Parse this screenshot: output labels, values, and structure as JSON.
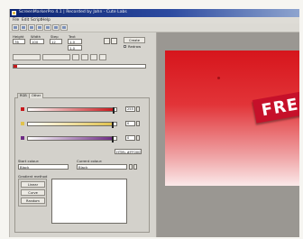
{
  "window": {
    "title": "ScreenMarkerPro 4.1 | Recorded by Jahn - Cute Labs"
  },
  "menu": [
    "File",
    "Edit",
    "Script",
    "Help"
  ],
  "toolbar": {
    "icons": [
      "new-icon",
      "open-icon",
      "save-icon",
      "cut-icon",
      "copy-icon",
      "paste-icon",
      "undo-icon"
    ]
  },
  "params": {
    "header_labels": [
      "Height",
      "Width",
      "Step",
      "Text"
    ],
    "values": [
      "76",
      "100",
      "12",
      "1.0"
    ],
    "extra_value": "1.0",
    "options": [
      {
        "label": "Create"
      },
      {
        "label": "Redraw"
      }
    ]
  },
  "tabs": [
    {
      "label": "RGB"
    },
    {
      "label": "Other"
    }
  ],
  "sliders": [
    {
      "color": "#c8181c",
      "value": "255",
      "level": 0.97
    },
    {
      "color": "#e0c24c",
      "value": "0",
      "level": 0.96
    },
    {
      "color": "#6d2b84",
      "value": "0",
      "level": 0.96
    }
  ],
  "html_value": "HTML #FF0000",
  "colors": {
    "start_label": "Start colour:",
    "start_value": "Black",
    "current_label": "Current colour:",
    "current_value": "Black"
  },
  "gradient": {
    "label": "Gradient method",
    "methods": [
      {
        "label": "Linear"
      },
      {
        "label": "Curve"
      },
      {
        "label": "Random"
      }
    ]
  },
  "canvas": {
    "badge_text": "FRE"
  }
}
